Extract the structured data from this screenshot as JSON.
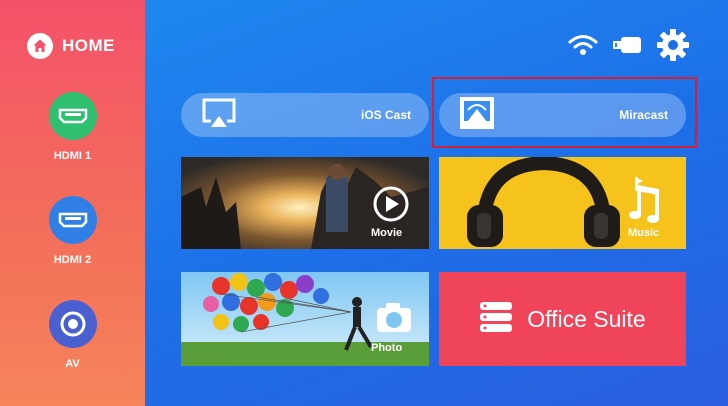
{
  "sidebar": {
    "home_label": "HOME",
    "sources": [
      {
        "label": "HDMI 1",
        "icon": "hdmi-icon",
        "color": "#2fbf71"
      },
      {
        "label": "HDMI 2",
        "icon": "hdmi-icon",
        "color": "#2f7fe6"
      },
      {
        "label": "AV",
        "icon": "av-icon",
        "color": "#4a5fd0"
      }
    ]
  },
  "status": {
    "icons": [
      "wifi-icon",
      "usb-icon",
      "gear-icon"
    ]
  },
  "cast": {
    "ios_label": "iOS Cast",
    "miracast_label": "Miracast"
  },
  "tiles": {
    "movie_label": "Movie",
    "music_label": "Music",
    "photo_label": "Photo",
    "office_label": "Office Suite"
  },
  "colors": {
    "sidebar_top": "#f4516a",
    "sidebar_bottom": "#f5845a",
    "background": "#1f8cf0",
    "music_bg": "#f6c21c",
    "office_bg": "#f0445a",
    "highlight": "#d0213a"
  }
}
